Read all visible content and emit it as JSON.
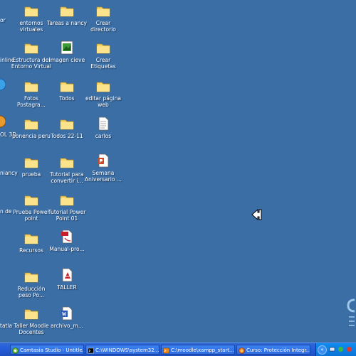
{
  "desktop": {
    "left_labels": [
      "or",
      "inline",
      "OL 3D",
      "niancy",
      "n de",
      "tatla"
    ],
    "icons": [
      {
        "label": "entornos\nvirtuales",
        "icon": "folder-icon"
      },
      {
        "label": "Tareas a nancy",
        "icon": "folder-icon"
      },
      {
        "label": "Crear\ndirectorio",
        "icon": "folder-icon"
      },
      {
        "label": "Estructura del\nEntorno Virtual",
        "icon": "folder-icon"
      },
      {
        "label": "imagen cieve",
        "icon": "image-file-icon"
      },
      {
        "label": "Crear\nEtiquetas",
        "icon": "folder-icon"
      },
      {
        "label": "Fotos\nPostagra...",
        "icon": "folder-icon"
      },
      {
        "label": "Todos",
        "icon": "folder-icon"
      },
      {
        "label": "editar página\nweb",
        "icon": "folder-icon"
      },
      {
        "label": "ponencia peru",
        "icon": "folder-icon"
      },
      {
        "label": "Todos 22-11",
        "icon": "folder-icon"
      },
      {
        "label": "carlos",
        "icon": "text-file-icon"
      },
      {
        "label": "prueba",
        "icon": "folder-icon"
      },
      {
        "label": "Tutorial para\nconvertir i...",
        "icon": "folder-icon"
      },
      {
        "label": "Semana\nAniversario ...",
        "icon": "powerpoint-file-icon"
      },
      {
        "label": "Prueba Power\npoint",
        "icon": "folder-icon"
      },
      {
        "label": "Tutorial Power\nPoint 01",
        "icon": "folder-icon"
      },
      {
        "label": "Recursos",
        "icon": "folder-icon"
      },
      {
        "label": "Manual-pro...",
        "icon": "pdf-file-icon"
      },
      {
        "label": "Reducción\npeso Po...",
        "icon": "folder-icon"
      },
      {
        "label": "TALLER",
        "icon": "taller-app-icon"
      },
      {
        "label": "Taller Moodle\nDocentes",
        "icon": "folder-icon"
      },
      {
        "label": "archivo_m...",
        "icon": "word-file-icon"
      }
    ]
  },
  "taskbar": {
    "tasks": [
      {
        "label": "Camtasia Studio - Untitle...",
        "icon": "camtasia-icon"
      },
      {
        "label": "C:\\WINDOWS\\system32...",
        "icon": "console-icon"
      },
      {
        "label": "C:\\moodle\\xampp_start....",
        "icon": "console-icon"
      },
      {
        "label": "Curso: Protección Integr...",
        "icon": "browser-icon"
      }
    ],
    "tray_arrow": "«"
  },
  "colors": {
    "desktop_background": "#3a6ea5",
    "taskbar": "#245edb",
    "tray": "#0f8cf0",
    "folder": "#f7d46a"
  }
}
